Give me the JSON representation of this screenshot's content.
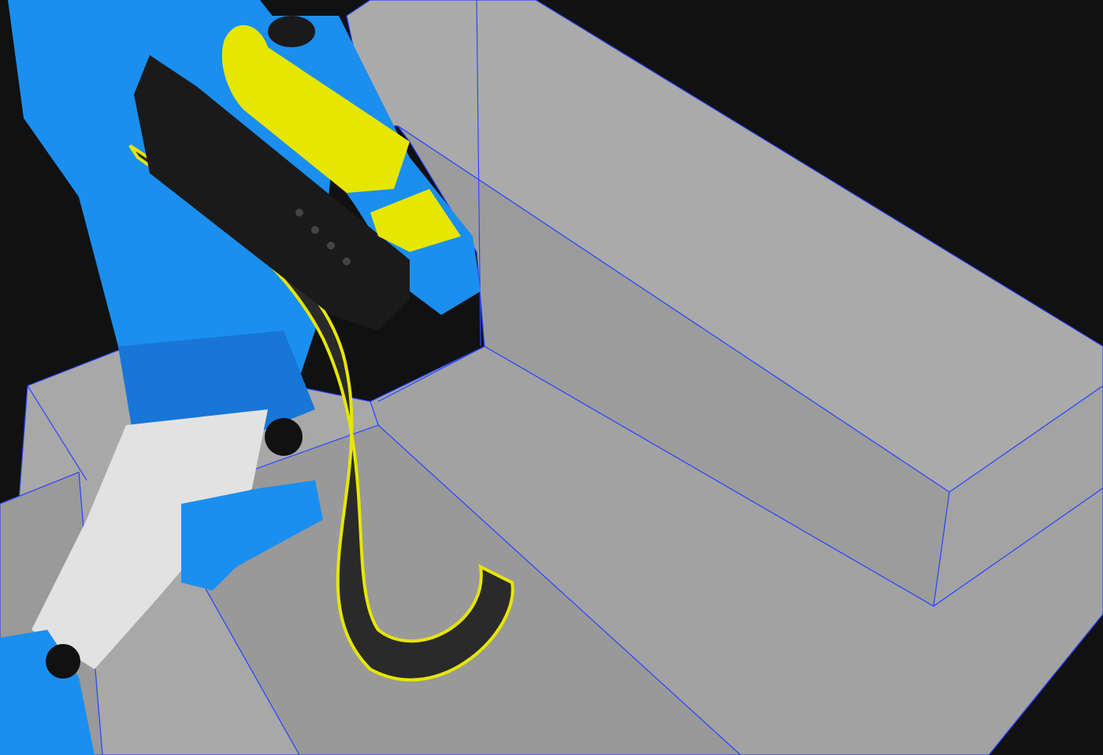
{
  "scene": {
    "background_color": "#111111",
    "stair_color": "#a6a6a6",
    "edge_line_color": "#1e3cff",
    "figure_color": "#1a8ff0",
    "accent_color": "#e6e600",
    "gun_color": "#1a1a1a",
    "leg_color": "#e0e0e0"
  }
}
